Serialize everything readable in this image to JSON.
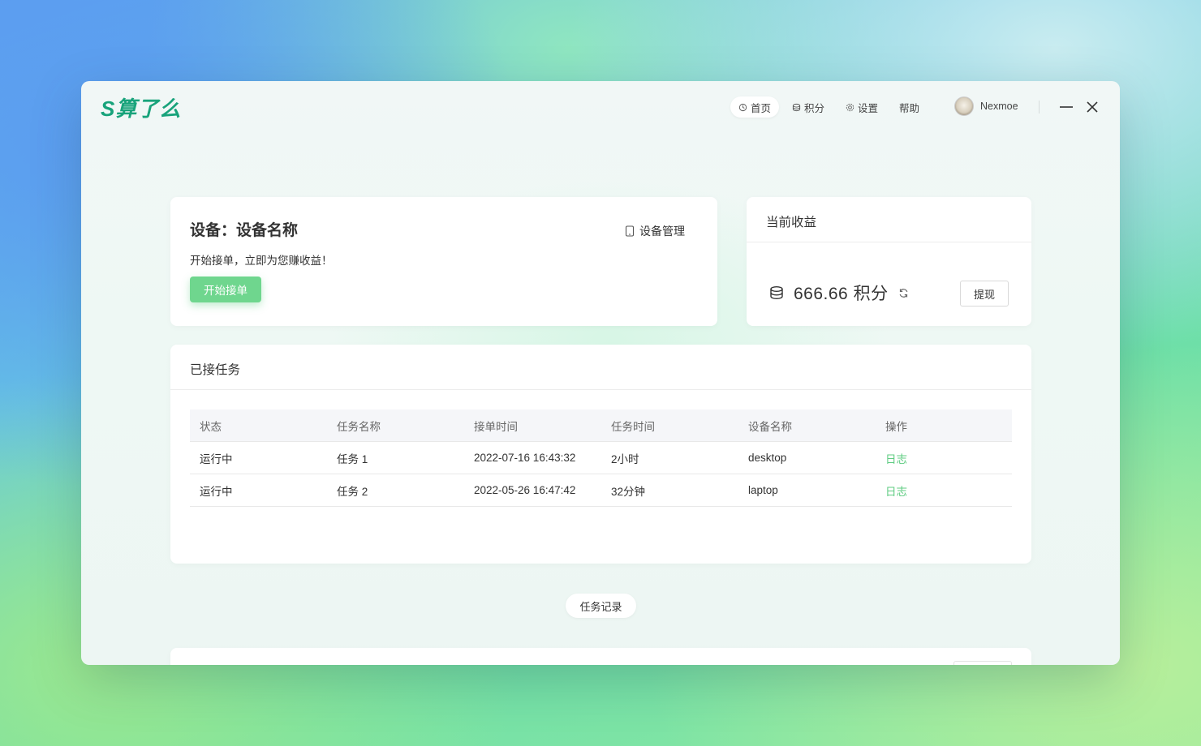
{
  "app": {
    "logo_text": "S算了么"
  },
  "nav": {
    "items": [
      {
        "label": "首页",
        "icon": "home-icon",
        "active": true
      },
      {
        "label": "积分",
        "icon": "coins-icon",
        "active": false
      },
      {
        "label": "设置",
        "icon": "gear-icon",
        "active": false
      },
      {
        "label": "帮助",
        "icon": "",
        "active": false
      }
    ]
  },
  "user": {
    "name": "Nexmoe"
  },
  "device_card": {
    "title": "设备：设备名称",
    "manage_label": "设备管理",
    "subtitle": "开始接单，立即为您赚收益！",
    "start_button": "开始接单"
  },
  "earnings_card": {
    "title": "当前收益",
    "value": "666.66 积分",
    "withdraw_button": "提现"
  },
  "tasks_card": {
    "title": "已接任务",
    "columns": [
      "状态",
      "任务名称",
      "接单时间",
      "任务时间",
      "设备名称",
      "操作"
    ],
    "rows": [
      {
        "status": "运行中",
        "name": "任务 1",
        "accepted_at": "2022-07-16 16:43:32",
        "duration": "2小时",
        "device": "desktop",
        "action": "日志"
      },
      {
        "status": "运行中",
        "name": "任务 2",
        "accepted_at": "2022-05-26 16:47:42",
        "duration": "32分钟",
        "device": "laptop",
        "action": "日志"
      }
    ]
  },
  "history_button": "任务记录",
  "colors": {
    "brand": "#18a37b",
    "accent_green": "#6fd68e",
    "link_green": "#5fcc82"
  }
}
